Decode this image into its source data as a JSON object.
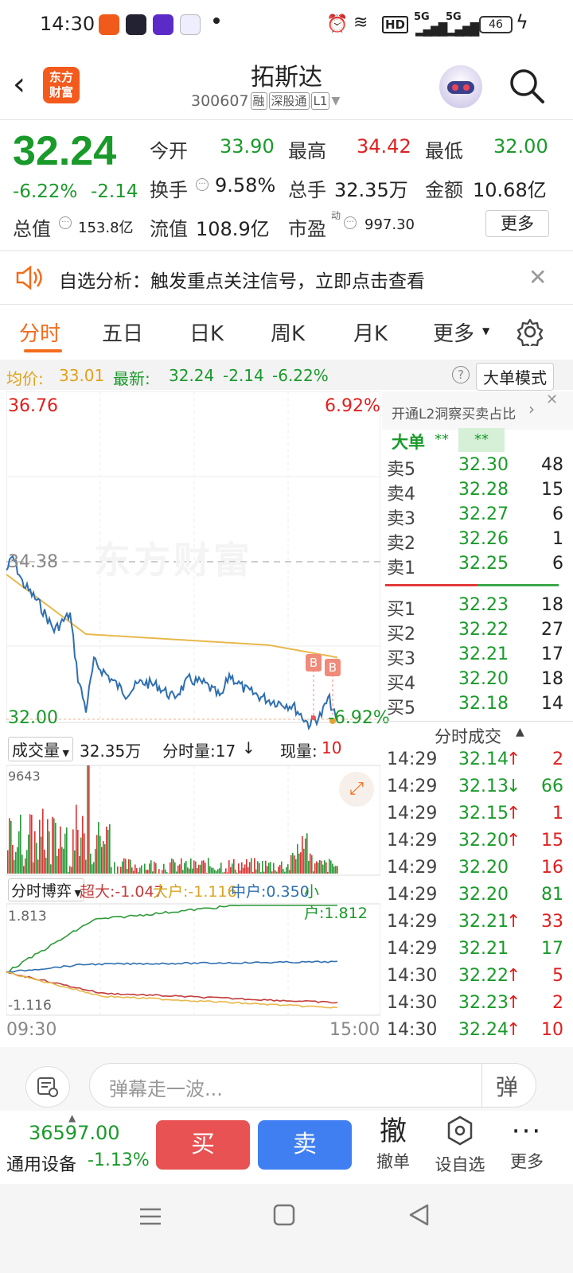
{
  "status_bar": {
    "time": "14:30",
    "network": "HD",
    "signal1": "5G",
    "signal2": "5G",
    "battery": "46"
  },
  "header": {
    "title": "拓斯达",
    "code": "300607",
    "tags": [
      "融",
      "深股通",
      "L1"
    ],
    "logo_text": "东方财富"
  },
  "quote": {
    "price": "32.24",
    "change_pct": "-6.22%",
    "change": "-2.14",
    "fields": [
      {
        "label": "今开",
        "value": "33.90",
        "color": "green"
      },
      {
        "label": "最高",
        "value": "34.42",
        "color": "red"
      },
      {
        "label": "最低",
        "value": "32.00",
        "color": "green"
      },
      {
        "label": "换手",
        "value": "9.58%",
        "color": "black"
      },
      {
        "label": "总手",
        "value": "32.35万",
        "color": "black"
      },
      {
        "label": "金额",
        "value": "10.68亿",
        "color": "black"
      },
      {
        "label": "总值",
        "value": "153.8亿",
        "color": "black"
      },
      {
        "label": "流值",
        "value": "108.9亿",
        "color": "black"
      },
      {
        "label": "市盈",
        "value": "997.30",
        "color": "black",
        "sup": "动"
      }
    ],
    "more_label": "更多"
  },
  "banner": {
    "text": "自选分析：触发重点关注信号，立即点击查看"
  },
  "tabs": [
    "分时",
    "五日",
    "日K",
    "周K",
    "月K",
    "更多"
  ],
  "active_tab": "分时",
  "ribbon": {
    "avg_label": "均价:",
    "avg": "33.01",
    "latest_label": "最新:",
    "latest": "32.24",
    "chg": "-2.14",
    "pct": "-6.22%",
    "mode_label": "大单模式"
  },
  "chart": {
    "y_top": "36.76",
    "y_top_pct": "6.92%",
    "y_mid": "34.38",
    "y_bot": "32.00",
    "y_bot_pct": "-6.92%",
    "watermark": "东方财富",
    "markers": [
      "B",
      "B"
    ],
    "vol_label": "成交量",
    "vol_total": "32.35万",
    "fs_label": "分时量:17",
    "now_label": "现量:",
    "now": "10",
    "vol_max": "9643",
    "game_label": "分时博弈",
    "super": "超大:-1.047",
    "big": "大户:-1.116",
    "mid": "中户:0.350",
    "small": "小户:1.812",
    "g_top": "1.813",
    "g_bot": "-1.116",
    "t_start": "09:30",
    "t_end": "15:00"
  },
  "book": {
    "promo": "开通L2洞察买卖占比",
    "big_order_label": "大单",
    "big_order_a": "**",
    "big_order_b": "**",
    "asks": [
      {
        "l": "卖5",
        "p": "32.30",
        "q": "48"
      },
      {
        "l": "卖4",
        "p": "32.28",
        "q": "15"
      },
      {
        "l": "卖3",
        "p": "32.27",
        "q": "6"
      },
      {
        "l": "卖2",
        "p": "32.26",
        "q": "1"
      },
      {
        "l": "卖1",
        "p": "32.25",
        "q": "6"
      }
    ],
    "bids": [
      {
        "l": "买1",
        "p": "32.23",
        "q": "18"
      },
      {
        "l": "买2",
        "p": "32.22",
        "q": "27"
      },
      {
        "l": "买3",
        "p": "32.21",
        "q": "17"
      },
      {
        "l": "买4",
        "p": "32.20",
        "q": "18"
      },
      {
        "l": "买5",
        "p": "32.18",
        "q": "14"
      }
    ],
    "trades_title": "分时成交",
    "trades": [
      {
        "t": "14:29",
        "p": "32.14",
        "d": "↑",
        "q": "2",
        "c": "red"
      },
      {
        "t": "14:29",
        "p": "32.13",
        "d": "↓",
        "q": "66",
        "c": "green"
      },
      {
        "t": "14:29",
        "p": "32.15",
        "d": "↑",
        "q": "1",
        "c": "red"
      },
      {
        "t": "14:29",
        "p": "32.20",
        "d": "↑",
        "q": "15",
        "c": "red"
      },
      {
        "t": "14:29",
        "p": "32.20",
        "d": "",
        "q": "16",
        "c": "red"
      },
      {
        "t": "14:29",
        "p": "32.20",
        "d": "",
        "q": "81",
        "c": "green"
      },
      {
        "t": "14:29",
        "p": "32.21",
        "d": "↑",
        "q": "33",
        "c": "red"
      },
      {
        "t": "14:29",
        "p": "32.21",
        "d": "",
        "q": "17",
        "c": "green"
      },
      {
        "t": "14:30",
        "p": "32.22",
        "d": "↑",
        "q": "5",
        "c": "red"
      },
      {
        "t": "14:30",
        "p": "32.23",
        "d": "↑",
        "q": "2",
        "c": "red"
      },
      {
        "t": "14:30",
        "p": "32.24",
        "d": "↑",
        "q": "10",
        "c": "red"
      }
    ]
  },
  "danmaku": {
    "placeholder": "弹幕走一波...",
    "btn": "弹"
  },
  "bottom": {
    "index_value": "36597.00",
    "index_name": "通用设备",
    "index_pct": "-1.13%",
    "buy": "买",
    "sell": "卖",
    "cancel_icon": "撤",
    "cancel": "撤单",
    "watch": "设自选",
    "more": "更多"
  }
}
